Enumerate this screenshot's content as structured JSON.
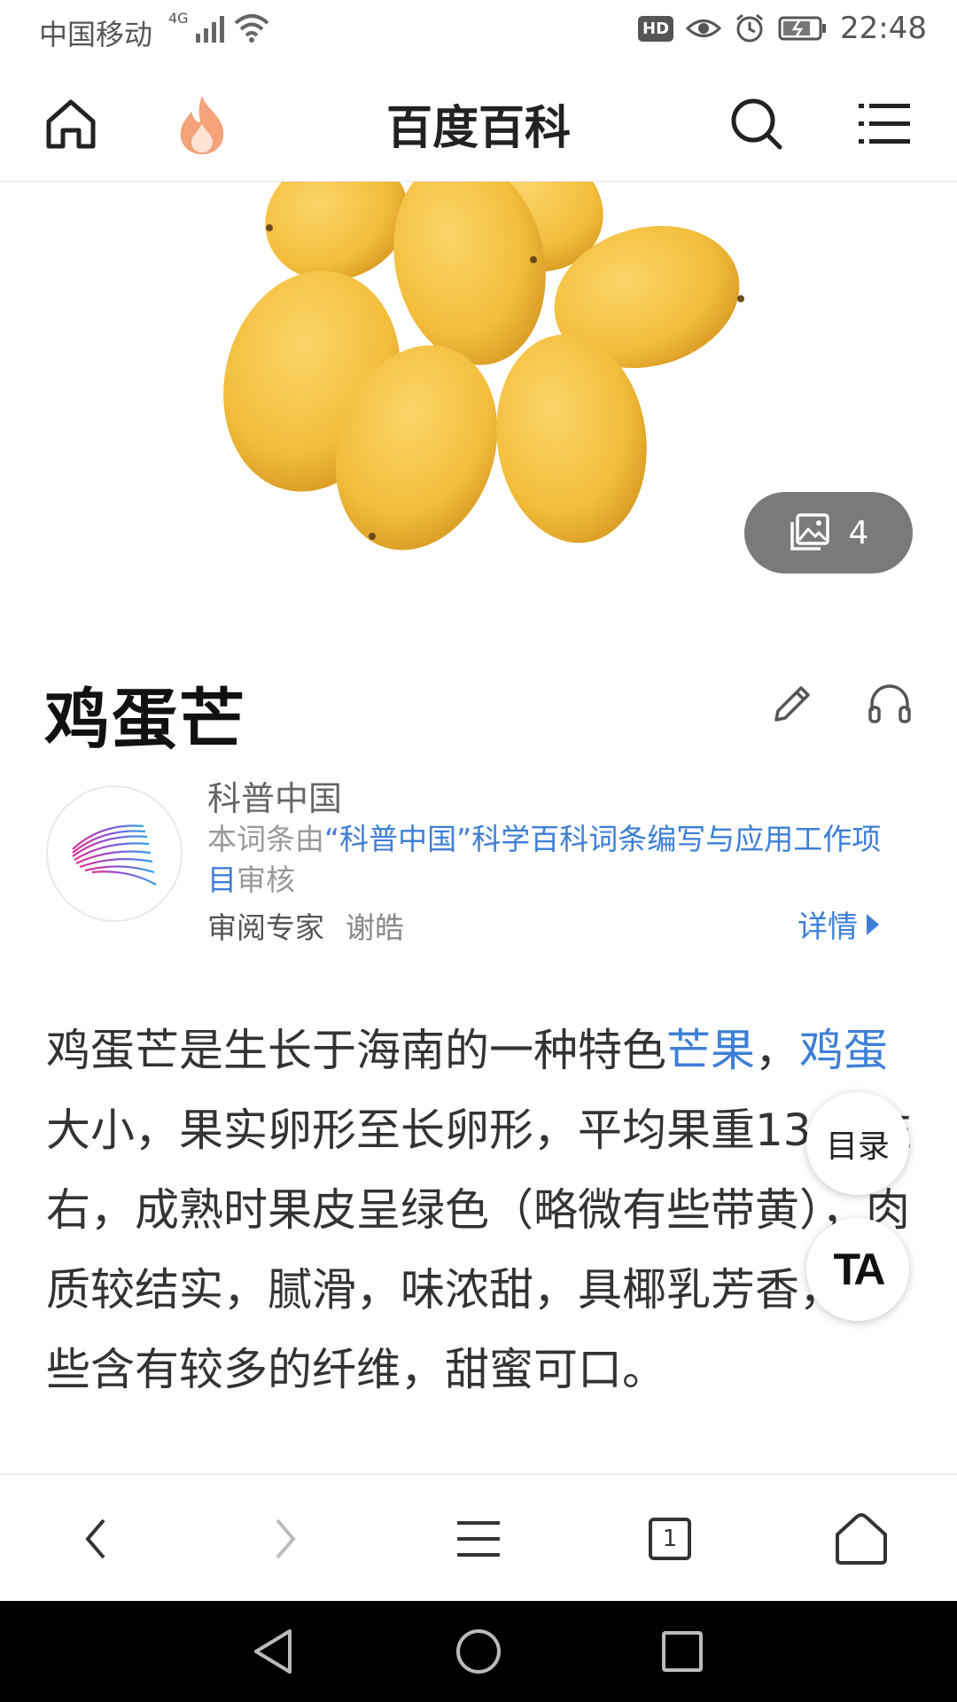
{
  "status_bar": {
    "carrier": "中国移动",
    "network": "4G",
    "hd_badge": "HD",
    "time": "22:48"
  },
  "header": {
    "title": "百度百科",
    "icons": [
      "home-icon",
      "fire-icon",
      "search-icon",
      "menu-icon"
    ]
  },
  "hero": {
    "album_count": "4"
  },
  "entry": {
    "title": "鸡蛋芒"
  },
  "reviewer": {
    "org_name": "科普中国",
    "prefix": "本词条由",
    "project_link": "“科普中国”科学百科词条编写与应用工作项目",
    "suffix": "审核",
    "expert_label": "审阅专家",
    "expert_name": "谢皓",
    "details_label": "详情"
  },
  "article": {
    "part1": "鸡蛋芒是生长于海南的一种特色",
    "link1": "芒果",
    "part2": "，",
    "link2": "鸡蛋",
    "part3": "大小，果实卵形至长卵形，平均果重130g左右，成熟时果皮呈绿色（略微有些带黄），肉质较结实，腻滑，味浓甜，具椰乳芳香，有些含有较多的纤维，甜蜜可口。"
  },
  "floating": {
    "toc_label": "目录",
    "text_size_label": "TA"
  },
  "browser_bar": {
    "tabs_count": "1"
  },
  "colors": {
    "link": "#3d7fd6",
    "fire": "#f4a27a",
    "album_bg": "#7a7a7a"
  }
}
